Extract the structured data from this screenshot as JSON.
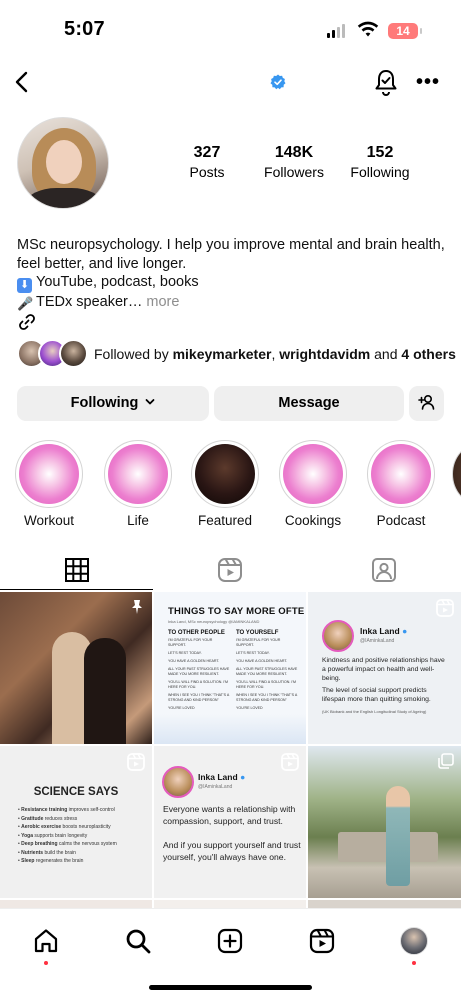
{
  "status_bar": {
    "time": "5:07",
    "battery": "14"
  },
  "colors": {
    "verified": "#3897f0",
    "highlight_pink": "#e45bbd",
    "notification_dot": "#ff3040"
  },
  "header": {
    "back_icon": "chevron-left-icon",
    "verified_icon": "verified-badge-icon",
    "notify_icon": "bell-check-icon",
    "more_icon": "more-horizontal-icon"
  },
  "profile": {
    "stats": [
      {
        "value": "327",
        "label": "Posts"
      },
      {
        "value": "148K",
        "label": "Followers"
      },
      {
        "value": "152",
        "label": "Following"
      }
    ],
    "bio_line1": "MSc neuropsychology. I help you improve mental and brain health,",
    "bio_line2": "feel better, and live longer.",
    "bio_line3": "YouTube, podcast, books",
    "bio_line4": "TEDx speaker…",
    "bio_more": "more",
    "followed_prefix": "Followed by ",
    "followed_user1": "mikeymarketer",
    "followed_sep": ", ",
    "followed_user2": "wrightdavidm",
    "followed_and": " and ",
    "followed_others": "4 others"
  },
  "actions": {
    "following": "Following",
    "message": "Message"
  },
  "highlights": [
    {
      "label": "Workout"
    },
    {
      "label": "Life"
    },
    {
      "label": "Featured"
    },
    {
      "label": "Cookings"
    },
    {
      "label": "Podcast"
    }
  ],
  "posts": {
    "post2": {
      "title": "THINGS TO SAY MORE OFTE",
      "subtitle": "Inka Land, MSc neuropsychology @IAMINKALAND",
      "col1_heading": "TO OTHER PEOPLE",
      "col2_heading": "TO YOURSELF",
      "col1": [
        "I'M GRATEFUL FOR YOUR SUPPORT.",
        "LET'S REST TODAY.",
        "YOU HAVE A GOLDEN HEART.",
        "ALL YOUR PAST STRUGGLES HAVE MADE YOU MORE RESILIENT.",
        "YOU'LL WILL FIND A SOLUTION. I'M HERE FOR YOU.",
        "WHEN I SEE YOU I THINK \"THAT'S A STRONG AND KIND PERSON\"",
        "YOU'RE LOVED"
      ],
      "col2": [
        "I'M GRATEFUL FOR YOUR SUPPORT.",
        "LET'S REST TODAY.",
        "YOU HAVE A GOLDEN HEART.",
        "ALL YOUR PAST STRUGGLES HAVE MADE YOU MORE RESILIENT.",
        "YOU'LL WILL FIND A SOLUTION. I'M HERE FOR YOU.",
        "WHEN I SEE YOU I THINK \"THAT'S A STRONG AND KIND PERSON\"",
        "YOU'RE LOVED"
      ]
    },
    "post3": {
      "name": "Inka Land",
      "handle": "@IAminkaLand",
      "p1": "Kindness and positive relationships have a powerful impact on health and well-being.",
      "p2": "The level of social support predicts lifespan more than quitting smoking.",
      "source": "(UK Biobank and the English Longitudinal Study of Ageing)"
    },
    "post4": {
      "title": "SCIENCE SAYS",
      "items": [
        {
          "bold": "Resistance training",
          "rest": " improves self-control"
        },
        {
          "bold": "Gratitude",
          "rest": " reduces stress"
        },
        {
          "bold": "Aerobic exercise",
          "rest": " boosts neuroplasticity"
        },
        {
          "bold": "Yoga",
          "rest": " supports brain longevity"
        },
        {
          "bold": "Deep breathing",
          "rest": " calms the nervous system"
        },
        {
          "bold": "Nutrients",
          "rest": " build the brain"
        },
        {
          "bold": "Sleep",
          "rest": " regenerates the brain"
        }
      ]
    },
    "post5": {
      "name": "Inka Land",
      "handle": "@IAminkaLand",
      "p1": "Everyone wants a relationship with compassion, support, and trust.",
      "p2": "And if you support yourself and trust yourself, you'll always have one."
    }
  },
  "bottom_nav": {
    "items": [
      "home-icon",
      "search-icon",
      "create-icon",
      "reels-icon",
      "profile-avatar"
    ]
  }
}
